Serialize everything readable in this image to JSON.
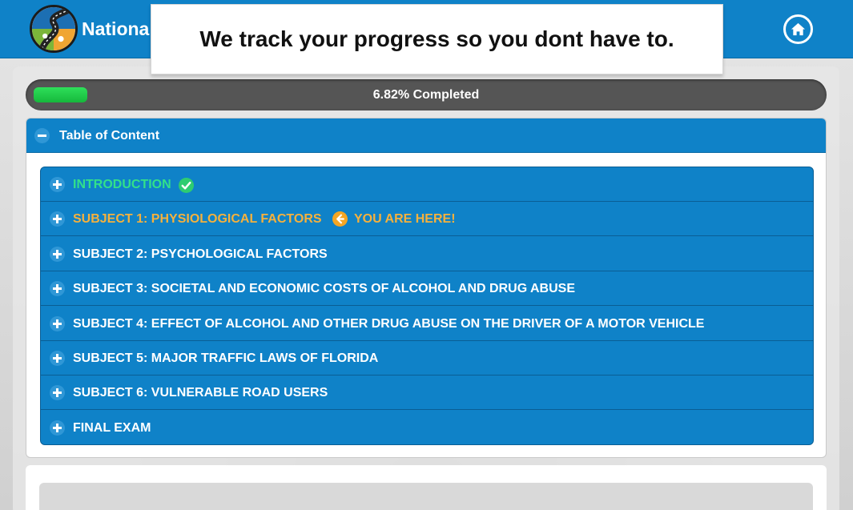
{
  "header": {
    "brand": "Nationa",
    "home_icon": "home-icon",
    "logo_icon": "road-logo-icon",
    "colors": {
      "primary": "#0f82c8",
      "done": "#32e08a",
      "current": "#f5b13d"
    }
  },
  "banner": {
    "text": "We track your progress so you dont have to."
  },
  "progress": {
    "percent": 6.82,
    "label": "6.82% Completed"
  },
  "toc": {
    "title": "Table of Content",
    "items": [
      {
        "label": "INTRODUCTION",
        "status": "done"
      },
      {
        "label": "SUBJECT 1: PHYSIOLOGICAL FACTORS",
        "status": "current",
        "marker": "YOU ARE HERE!"
      },
      {
        "label": "SUBJECT 2: PSYCHOLOGICAL FACTORS",
        "status": "pending"
      },
      {
        "label": "SUBJECT 3: SOCIETAL AND ECONOMIC COSTS OF ALCOHOL AND DRUG ABUSE",
        "status": "pending"
      },
      {
        "label": "SUBJECT 4: EFFECT OF ALCOHOL AND OTHER DRUG ABUSE ON THE DRIVER OF A MOTOR VEHICLE",
        "status": "pending"
      },
      {
        "label": "SUBJECT 5: MAJOR TRAFFIC LAWS OF FLORIDA",
        "status": "pending"
      },
      {
        "label": "SUBJECT 6: VULNERABLE ROAD USERS",
        "status": "pending"
      },
      {
        "label": "FINAL EXAM",
        "status": "pending"
      }
    ]
  }
}
